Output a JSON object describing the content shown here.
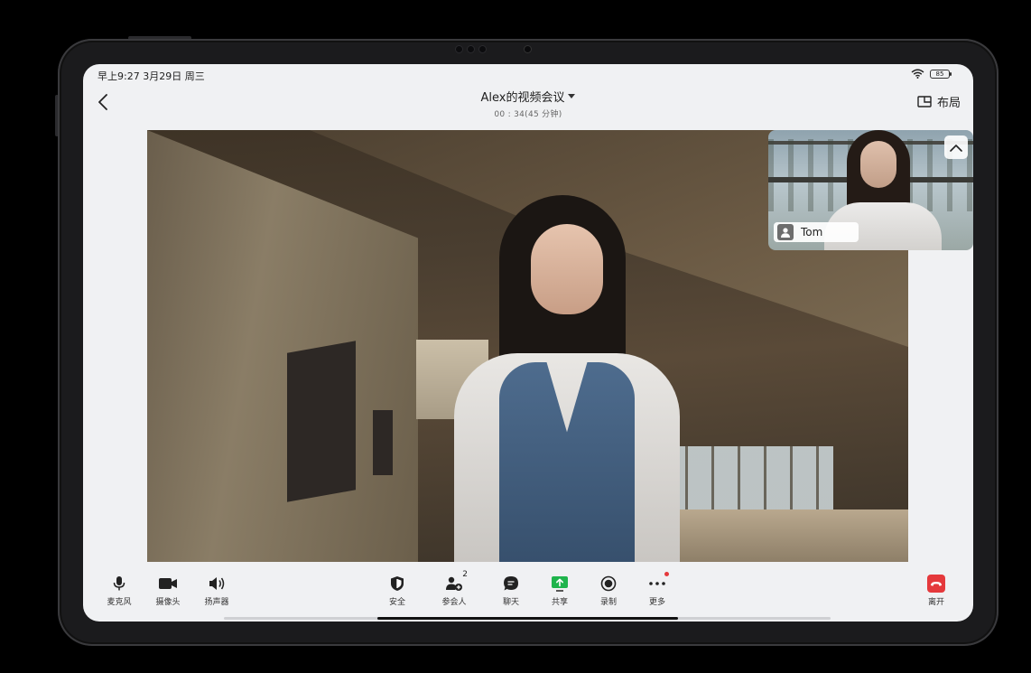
{
  "status_bar": {
    "time": "早上9:27 3月29日 周三",
    "battery": "85"
  },
  "header": {
    "title": "Alex的视频会议",
    "duration": "00 : 34(45 分钟)",
    "layout_label": "布局"
  },
  "pip": {
    "participant_name": "Tom"
  },
  "toolbar": {
    "mic": "麦克风",
    "camera": "摄像头",
    "speaker": "扬声器",
    "security": "安全",
    "participants": "参会人",
    "participants_count": "2",
    "chat": "聊天",
    "share": "共享",
    "record": "录制",
    "more": "更多",
    "leave": "离开"
  },
  "colors": {
    "share_green": "#1fb44c",
    "leave_red": "#e5393c",
    "screen_bg": "#f0f1f3"
  }
}
